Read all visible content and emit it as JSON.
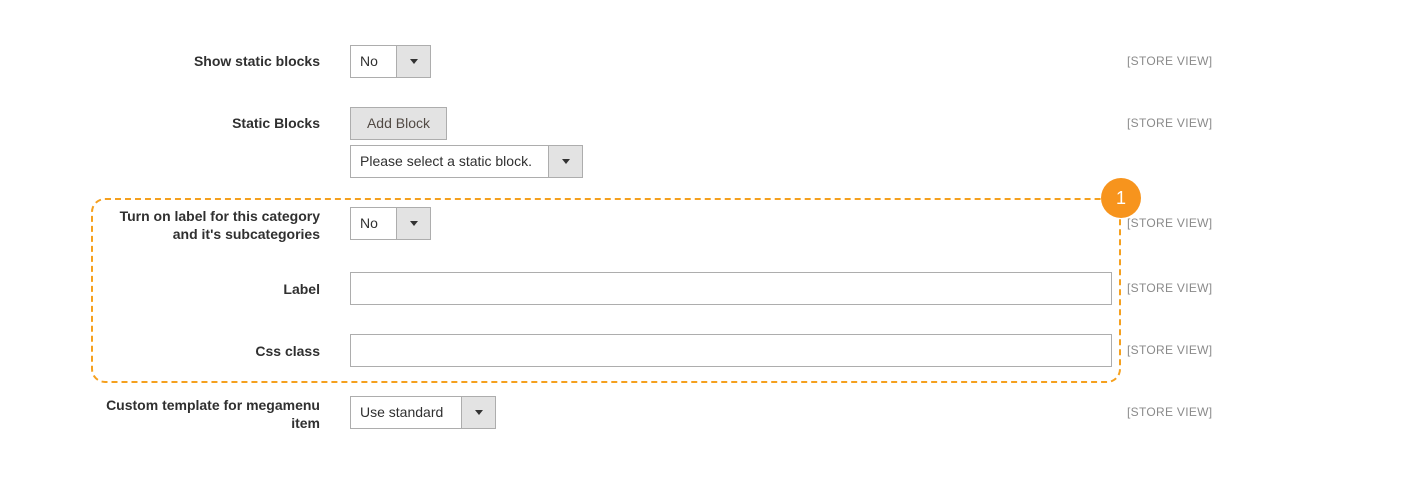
{
  "fields": {
    "show_static_blocks": {
      "label": "Show static blocks",
      "value": "No",
      "scope": "[STORE VIEW]"
    },
    "static_blocks": {
      "label": "Static Blocks",
      "add_button": "Add Block",
      "select_value": "Please select a static block.",
      "scope": "[STORE VIEW]"
    },
    "turn_on_label": {
      "label_line1": "Turn on label for this category",
      "label_line2": "and it's subcategories",
      "value": "No",
      "scope": "[STORE VIEW]"
    },
    "label": {
      "label": "Label",
      "value": "",
      "scope": "[STORE VIEW]"
    },
    "css_class": {
      "label": "Css class",
      "value": "",
      "scope": "[STORE VIEW]"
    },
    "custom_template": {
      "label_line1": "Custom template for megamenu",
      "label_line2": "item",
      "value": "Use standard",
      "scope": "[STORE VIEW]"
    }
  },
  "callout": {
    "number": "1",
    "color": "#f7941d"
  },
  "icons": {
    "dropdown": "triangle-down-icon"
  },
  "colors": {
    "dashed_border": "#f5a01e",
    "arrow_bg": "#e3e3e3",
    "border": "#adadad"
  }
}
